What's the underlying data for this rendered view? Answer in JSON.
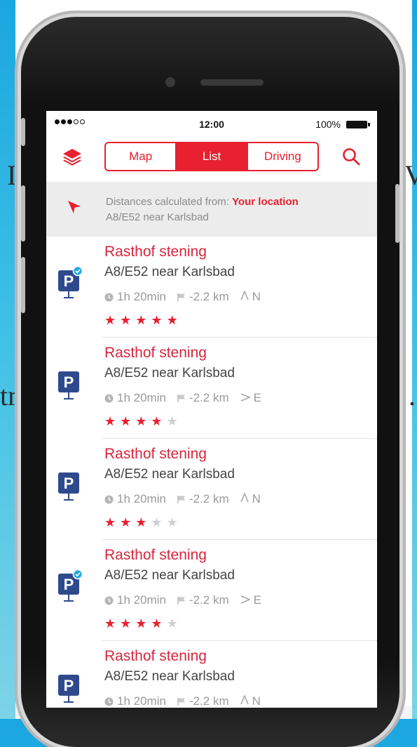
{
  "background_fragments": {
    "left_upper": "I",
    "left_lower": "tr",
    "right_upper": "V",
    "right_lower": "."
  },
  "status_bar": {
    "signal_dots": 5,
    "signal_filled": 3,
    "time": "12:00",
    "battery": "100%"
  },
  "toolbar": {
    "layers_icon": "layers-icon",
    "search_icon": "search-icon",
    "tabs": [
      {
        "label": "Map",
        "active": false
      },
      {
        "label": "List",
        "active": true
      },
      {
        "label": "Driving",
        "active": false
      }
    ]
  },
  "info_bar": {
    "icon": "location-arrow-icon",
    "prefix": "Distances calculated from:",
    "highlight": "Your location",
    "subline": "A8/E52 near Karlsbad"
  },
  "list": {
    "items": [
      {
        "title": "Rasthof stening",
        "subtitle": "A8/E52 near Karlsbad",
        "duration": "1h 20min",
        "distance": "-2.2 km",
        "direction": "N",
        "rating": 5,
        "verified": true
      },
      {
        "title": "Rasthof stening",
        "subtitle": "A8/E52 near Karlsbad",
        "duration": "1h 20min",
        "distance": "-2.2 km",
        "direction": "E",
        "rating": 4,
        "verified": false
      },
      {
        "title": "Rasthof stening",
        "subtitle": "A8/E52 near Karlsbad",
        "duration": "1h 20min",
        "distance": "-2.2 km",
        "direction": "N",
        "rating": 3,
        "verified": false
      },
      {
        "title": "Rasthof stening",
        "subtitle": "A8/E52 near Karlsbad",
        "duration": "1h 20min",
        "distance": "-2.2 km",
        "direction": "E",
        "rating": 4,
        "verified": true
      },
      {
        "title": "Rasthof stening",
        "subtitle": "A8/E52 near Karlsbad",
        "duration": "1h 20min",
        "distance": "-2.2 km",
        "direction": "N",
        "rating": 0,
        "verified": false
      }
    ],
    "star_max": 5
  },
  "colors": {
    "accent": "#e8202f",
    "title": "#d7263d",
    "pin": "#2f4a8c",
    "badge": "#27a9e1"
  }
}
